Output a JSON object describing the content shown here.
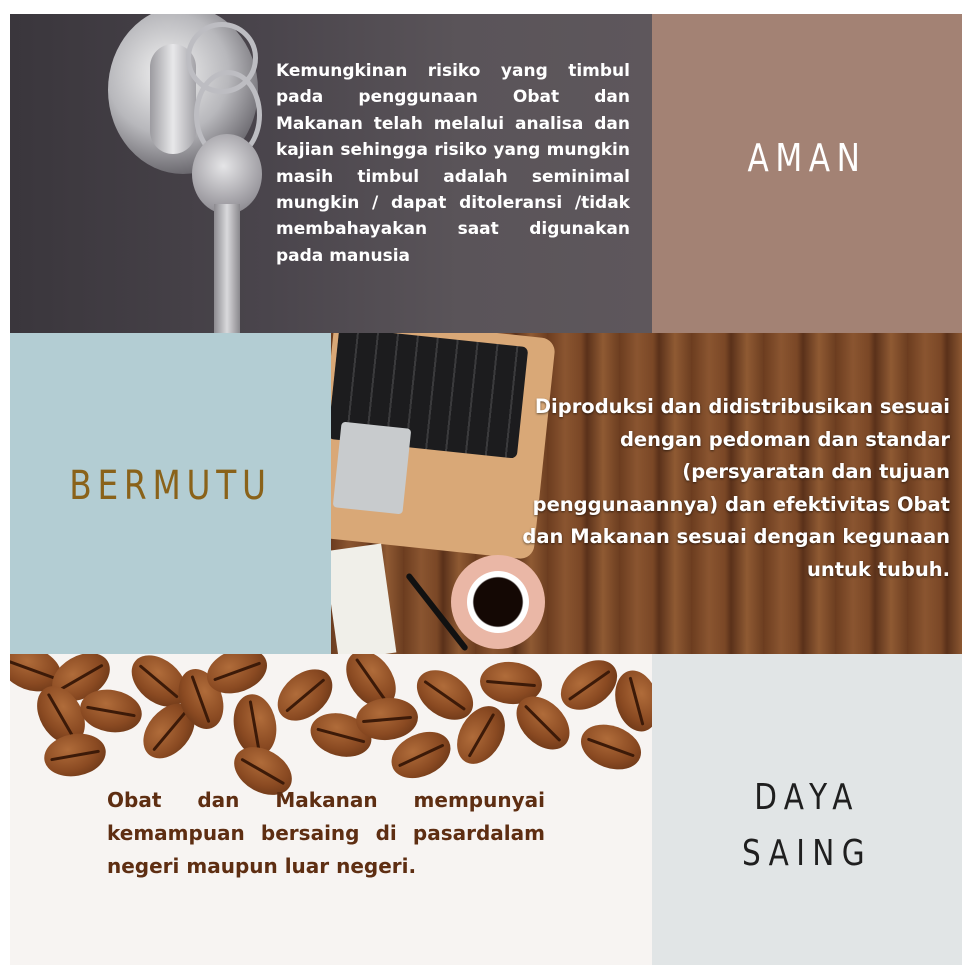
{
  "tiles": {
    "aman": {
      "title": "AMAN",
      "description": "Kemungkinan risiko yang timbul pada penggunaan Obat dan Makanan telah melalui analisa dan kajian sehingga risiko yang mungkin masih timbul adalah seminimal mungkin / dapat ditoleransi /tidak membahayakan saat digunakan pada manusia"
    },
    "bermutu": {
      "title": "BERMUTU",
      "description": "Diproduksi dan didistribusikan sesuai dengan pedoman dan standar (persyaratan dan tujuan penggunaannya) dan efektivitas Obat dan Makanan sesuai dengan kegunaan untuk tubuh."
    },
    "daya_saing": {
      "title_line1": "DAYA",
      "title_line2": "SAING",
      "description": "Obat dan Makanan mempunyai kemampuan bersaing di pasardalam negeri maupun luar negeri."
    }
  },
  "colors": {
    "aman_bg": "#a38274",
    "bermutu_bg": "#b3cdd3",
    "bermutu_title": "#8a6219",
    "daya_saing_bg": "#e1e5e6",
    "beans_text": "#5e2e12"
  }
}
